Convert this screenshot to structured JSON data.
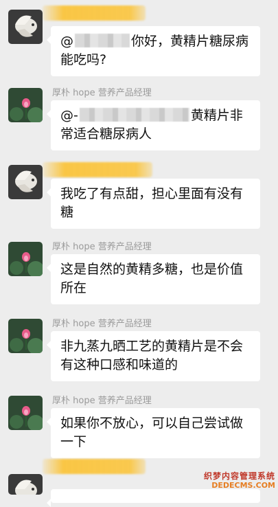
{
  "messages": [
    {
      "side": "user",
      "text_prefix": "@",
      "text": "你好，黄精片糖尿病能吃吗?"
    },
    {
      "side": "manager",
      "sender": "厚朴 hope 营养产品经理",
      "text_prefix": "@-",
      "text": "黄精片非常适合糖尿病人"
    },
    {
      "side": "user",
      "text": "我吃了有点甜，担心里面有没有糖"
    },
    {
      "side": "manager",
      "sender": "厚朴 hope 营养产品经理",
      "text": "这是自然的黄精多糖，也是价值所在"
    },
    {
      "side": "manager",
      "sender": "厚朴 hope 营养产品经理",
      "text": "非九蒸九晒工艺的黄精片是不会有这种口感和味道的"
    },
    {
      "side": "manager",
      "sender": "厚朴 hope 营养产品经理",
      "text": "如果你不放心，可以自己尝试做一下"
    }
  ],
  "watermark": {
    "line1": "织梦内容管理系统",
    "line2": "DEDECMS.COM"
  },
  "colors": {
    "background": "#ededed",
    "bubble": "#ffffff",
    "redaction": "#fac43c",
    "sender_text": "#9a9a9a"
  }
}
